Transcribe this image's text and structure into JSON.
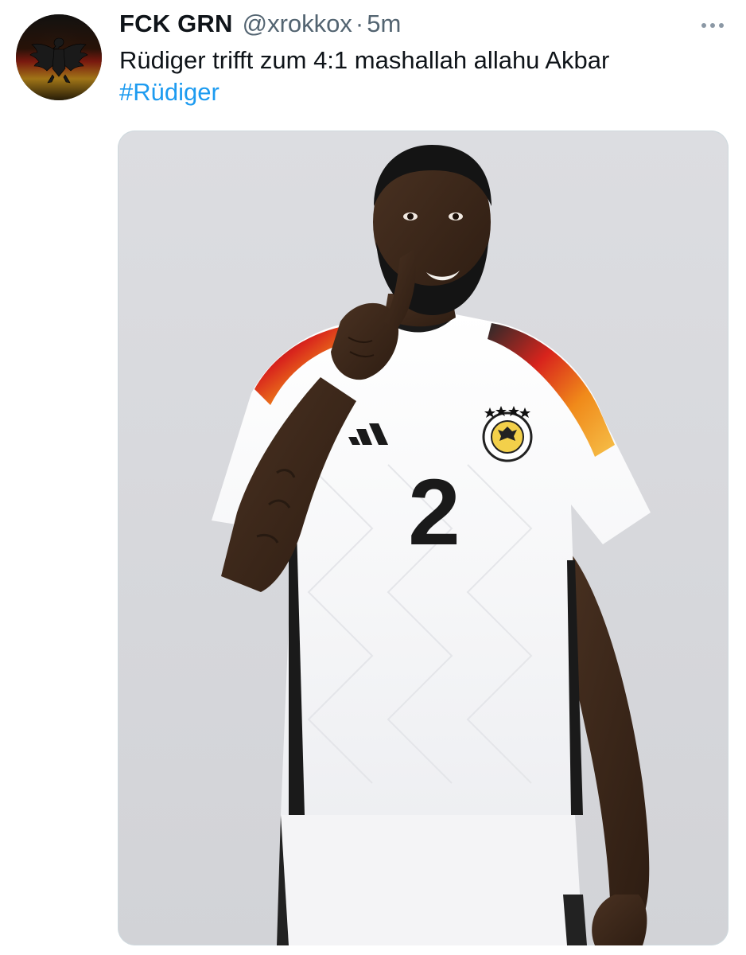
{
  "tweet": {
    "display_name": "FCK GRN",
    "handle": "@xrokkox",
    "separator": "·",
    "time": "5m",
    "text": "Rüdiger trifft zum 4:1 mashallah allahu Akbar",
    "hashtag": "#Rüdiger"
  },
  "media": {
    "alt": "Photo of a footballer in a white Germany jersey with number 2 holding a finger to his lips",
    "jersey_number": "2"
  },
  "icons": {
    "avatar": "eagle-emblem-avatar",
    "more": "more-options-icon"
  },
  "colors": {
    "link": "#1d9bf0",
    "secondary_text": "#536471",
    "primary_text": "#0f1419"
  }
}
